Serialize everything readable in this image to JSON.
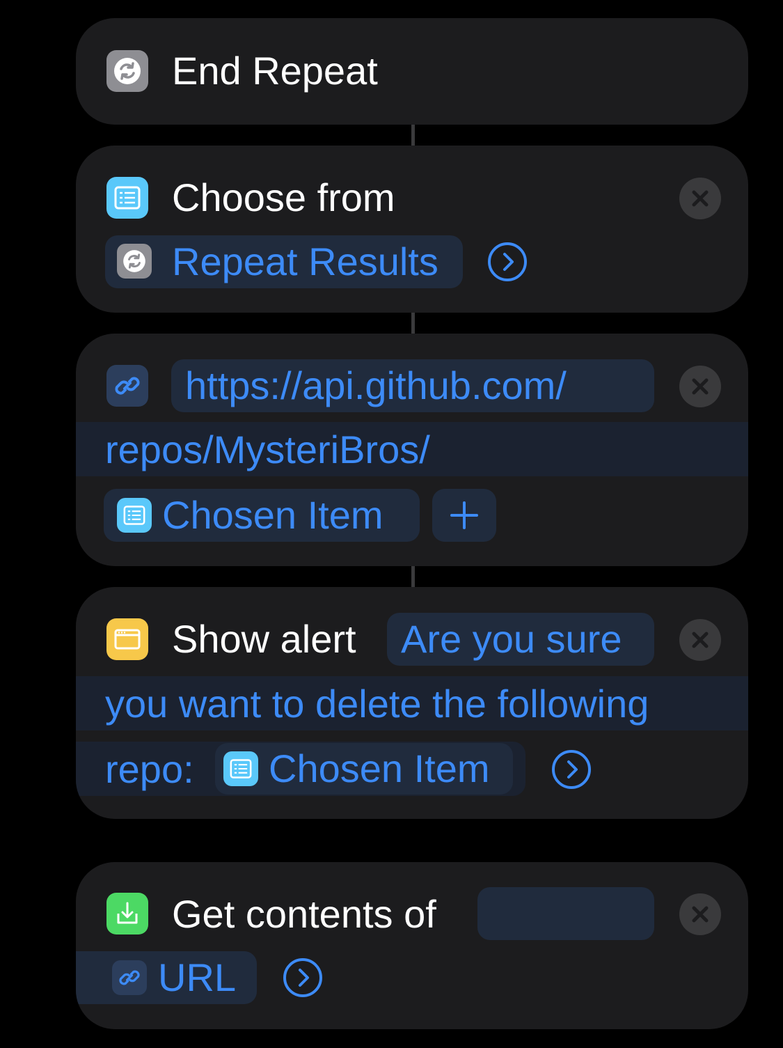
{
  "actions": [
    {
      "title": "End Repeat",
      "icon": "repeat-icon",
      "color": "#8e8e93"
    },
    {
      "title": "Choose from",
      "variable": "Repeat Results",
      "icon": "list-icon",
      "color": "#5ac8fa"
    },
    {
      "icon": "link-icon",
      "color": "#2c3e5c",
      "url_line1": "https://api.github.com/",
      "url_line2": "repos/MysteriBros/",
      "variable": "Chosen Item"
    },
    {
      "title": "Show alert",
      "icon": "alert-window-icon",
      "color": "#f7c84a",
      "msg_line1": "Are you sure",
      "msg_line2": "you want to delete the following",
      "msg_line3": "repo:",
      "variable": "Chosen Item"
    },
    {
      "title": "Get contents of",
      "icon": "download-icon",
      "color": "#4cd964",
      "variable": "URL"
    }
  ],
  "colors": {
    "accent": "#3d8bf7",
    "card": "#1c1c1e",
    "background": "#000000"
  }
}
